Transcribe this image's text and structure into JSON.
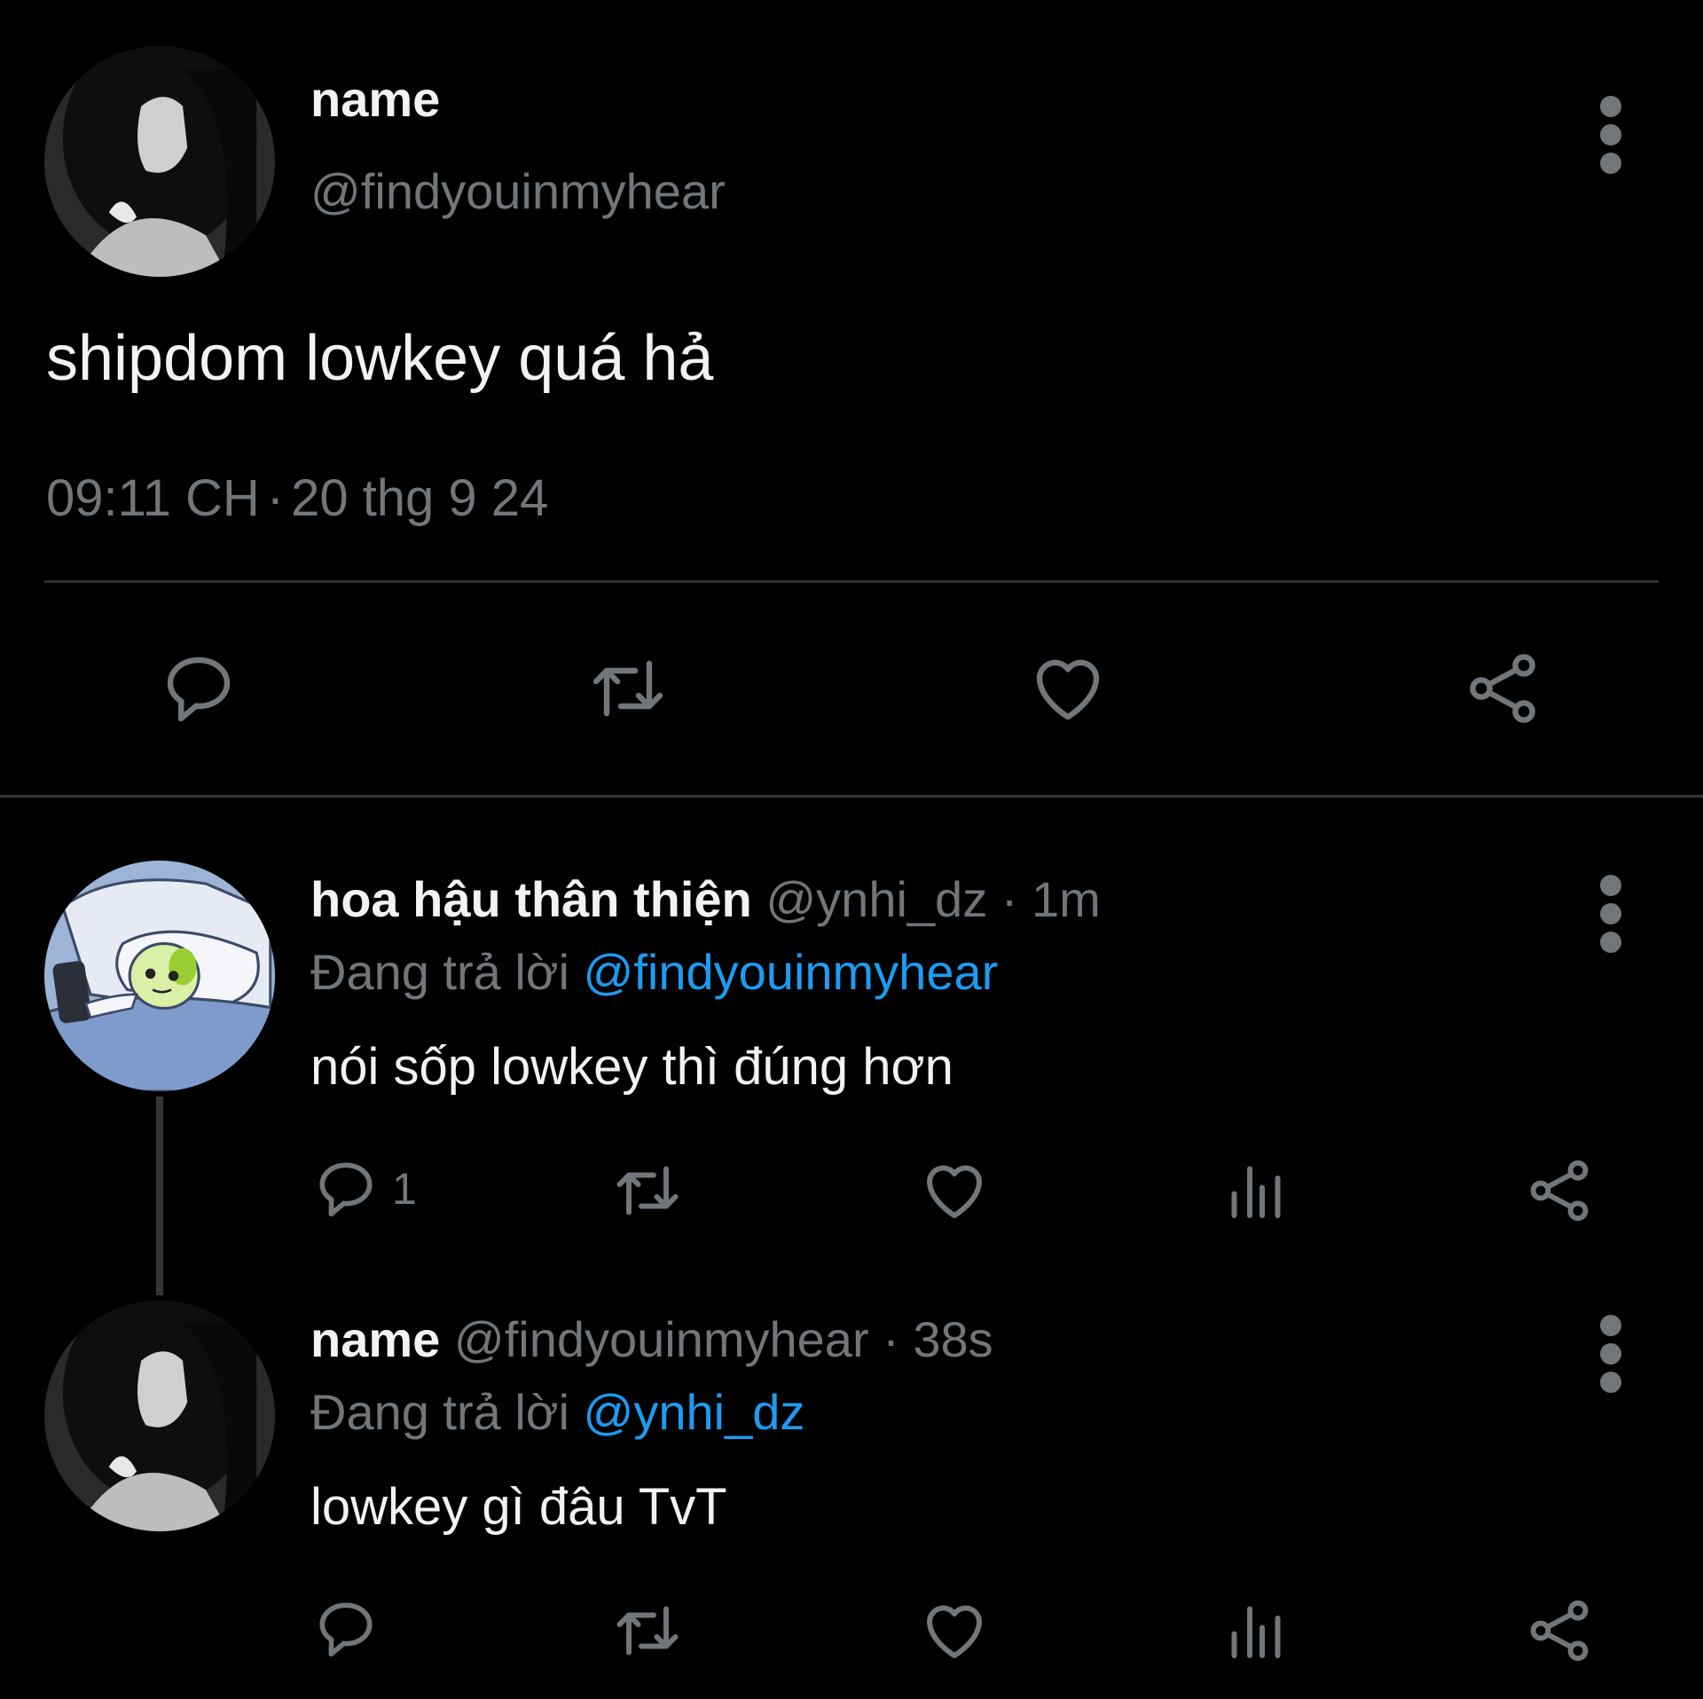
{
  "main_tweet": {
    "display_name": "name",
    "handle": "@findyouinmyhear",
    "text": "shipdom lowkey quá hả",
    "time": "09:11 CH",
    "separator": "·",
    "date": "20 thg 9 24",
    "actions": [
      "reply-icon",
      "retweet-icon",
      "like-icon",
      "share-icon"
    ]
  },
  "replies": [
    {
      "display_name": "hoa hậu thân thiện",
      "handle": "@ynhi_dz",
      "separator": "·",
      "time": "1m",
      "replying_prefix": "Đang trả lời",
      "replying_to": "@findyouinmyhear",
      "text": "nói sốp lowkey thì đúng hơn",
      "reply_count": "1"
    },
    {
      "display_name": "name",
      "handle": "@findyouinmyhear",
      "separator": "·",
      "time": "38s",
      "replying_prefix": "Đang trả lời",
      "replying_to": "@ynhi_dz",
      "text": "lowkey gì đâu TvT"
    }
  ],
  "colors": {
    "background": "#000000",
    "text_primary": "#f2f2f2",
    "text_secondary": "#71767b",
    "mention": "#1d9bf0",
    "divider": "#2f3336"
  }
}
